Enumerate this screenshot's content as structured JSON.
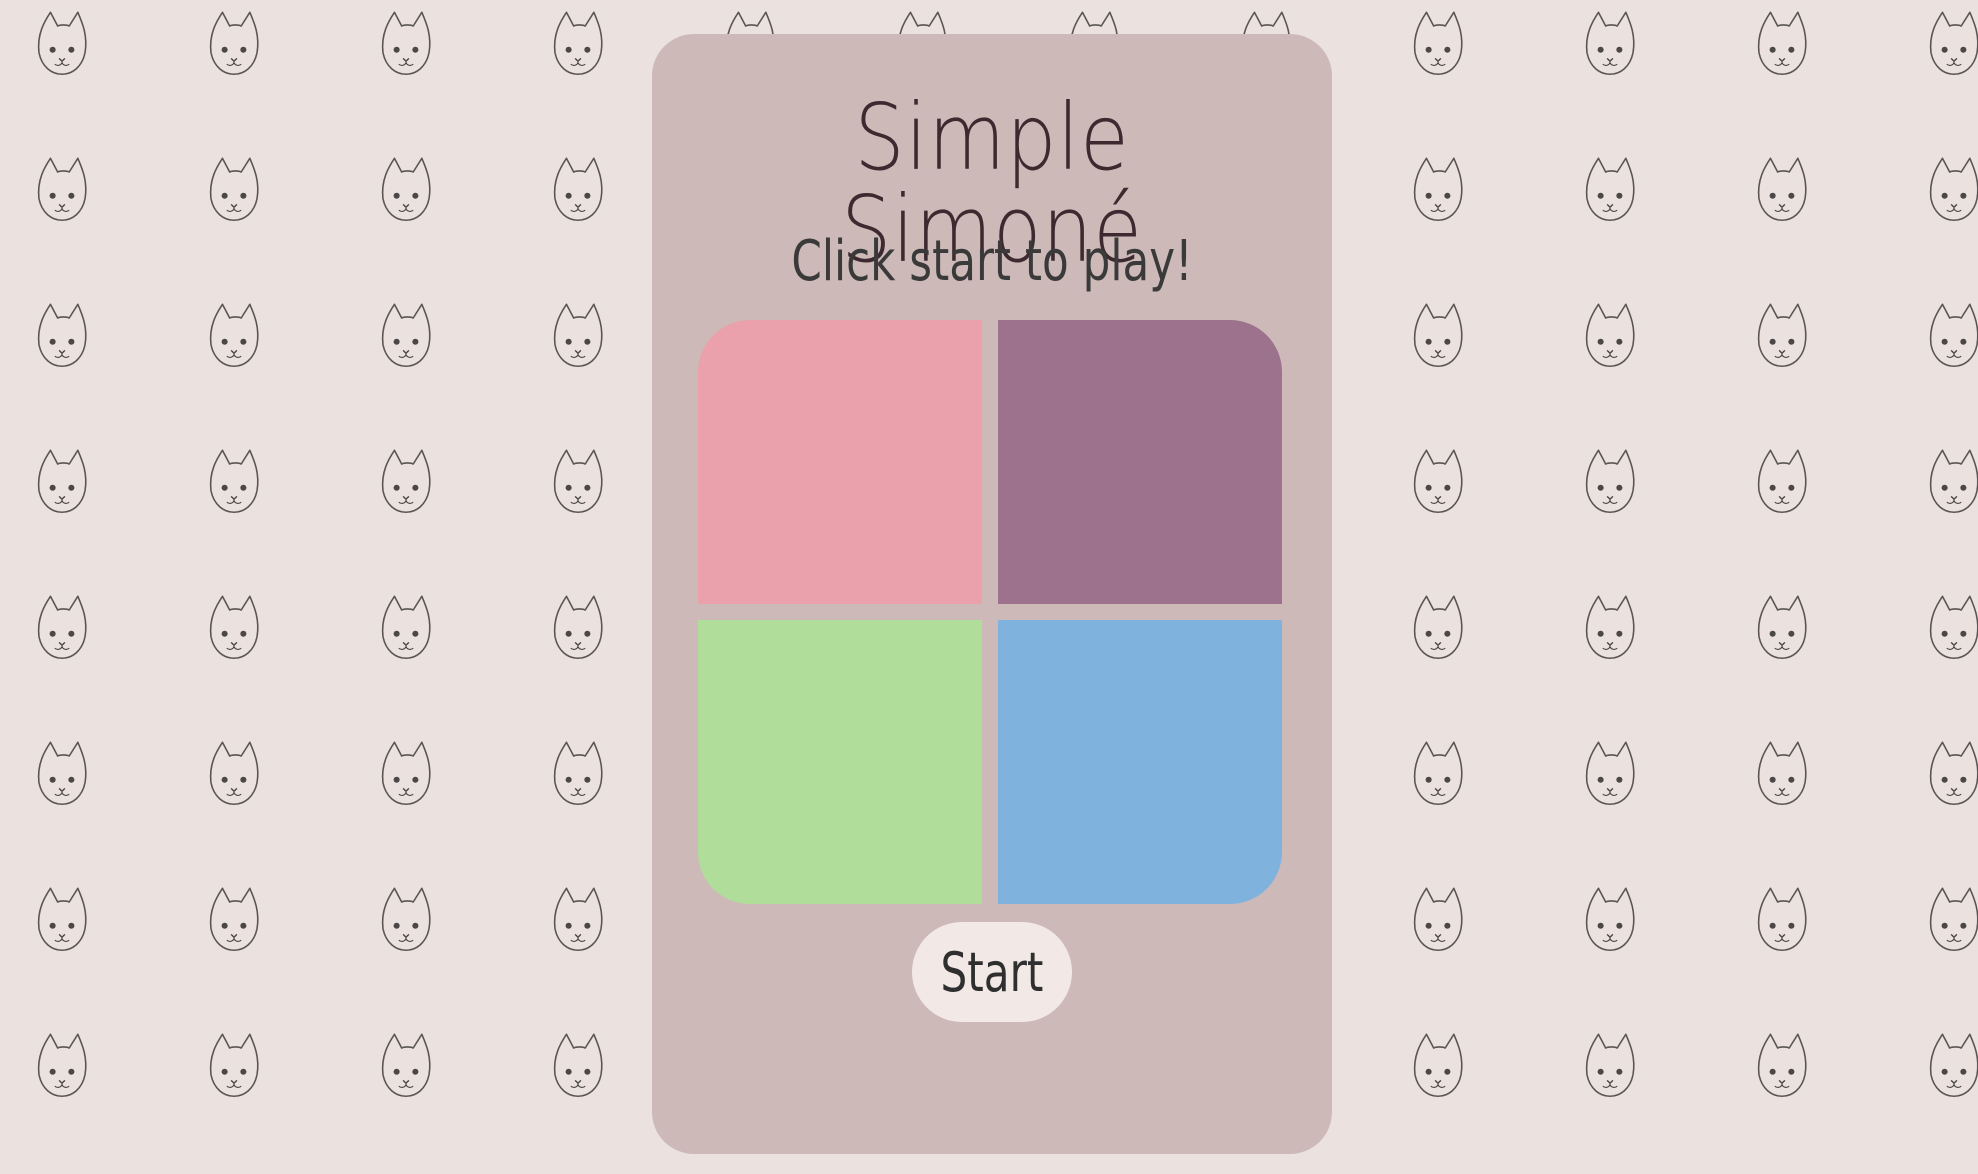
{
  "game": {
    "title": "Simple Simoné",
    "instructions": "Click start to play!",
    "start_label": "Start"
  },
  "pads": [
    {
      "color_name": "pink",
      "color": "#eaa1ab"
    },
    {
      "color_name": "purple",
      "color": "#9d728c"
    },
    {
      "color_name": "green",
      "color": "#b0de9a"
    },
    {
      "color_name": "blue",
      "color": "#7fb2dd"
    }
  ],
  "theme": {
    "background": "#ebe1df",
    "panel": "#cdbab8",
    "button": "#f2e9e7",
    "background_motif": "cat-face-icon"
  }
}
